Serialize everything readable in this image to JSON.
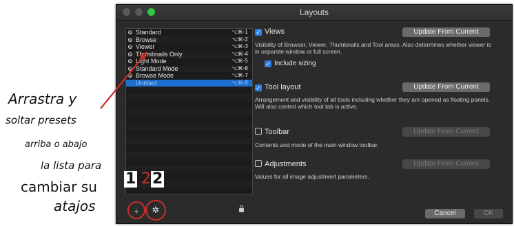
{
  "annotation": {
    "line1": "Arrastra y",
    "line2": "soltar presets",
    "line3": "arriba o abajo",
    "line4": "la lista para",
    "line5": "cambiar su",
    "line6": "atajos",
    "num1": "1",
    "num2": "2",
    "num3": "2"
  },
  "window": {
    "title": "Layouts"
  },
  "presets": [
    {
      "label": "Standard",
      "shortcut": "⌥⌘-1"
    },
    {
      "label": "Browse",
      "shortcut": "⌥⌘-2"
    },
    {
      "label": "Viewer",
      "shortcut": "⌥⌘-3"
    },
    {
      "label": "Thumbnails Only",
      "shortcut": "⌥⌘-4"
    },
    {
      "label": "Light Mode",
      "shortcut": "⌥⌘-5"
    },
    {
      "label": "Standard Mode",
      "shortcut": "⌥⌘-6"
    },
    {
      "label": "Browse Mode",
      "shortcut": "⌥⌘-7"
    },
    {
      "label": "Untitled",
      "shortcut": "⌥⌘-8"
    }
  ],
  "toolbar": {
    "add_label": "+",
    "gear_label": "✲"
  },
  "sections": {
    "views": {
      "label": "Views",
      "desc": "Visibility of Browser, Viewer, Thumbnails and Tool areas. Also determines whether viewer is in separate window or full screen.",
      "include_sizing": "Include sizing",
      "button": "Update From Current"
    },
    "tool_layout": {
      "label": "Tool layout",
      "desc": "Arrangement and visibility of all tools including whether they are opened as floating panels. Will also control which tool tab is active.",
      "button": "Update From Current"
    },
    "toolbar": {
      "label": "Toolbar",
      "desc": "Contents and mode of the main window toolbar.",
      "button": "Update From Current"
    },
    "adjustments": {
      "label": "Adjustments",
      "desc": "Values for all image adjustment parameters.",
      "button": "Update From Current"
    }
  },
  "footer": {
    "cancel": "Cancel",
    "ok": "OK"
  },
  "colors": {
    "accent": "#2f7fe0",
    "annotation_red": "#c8302c",
    "selection": "#1d6fcf"
  }
}
